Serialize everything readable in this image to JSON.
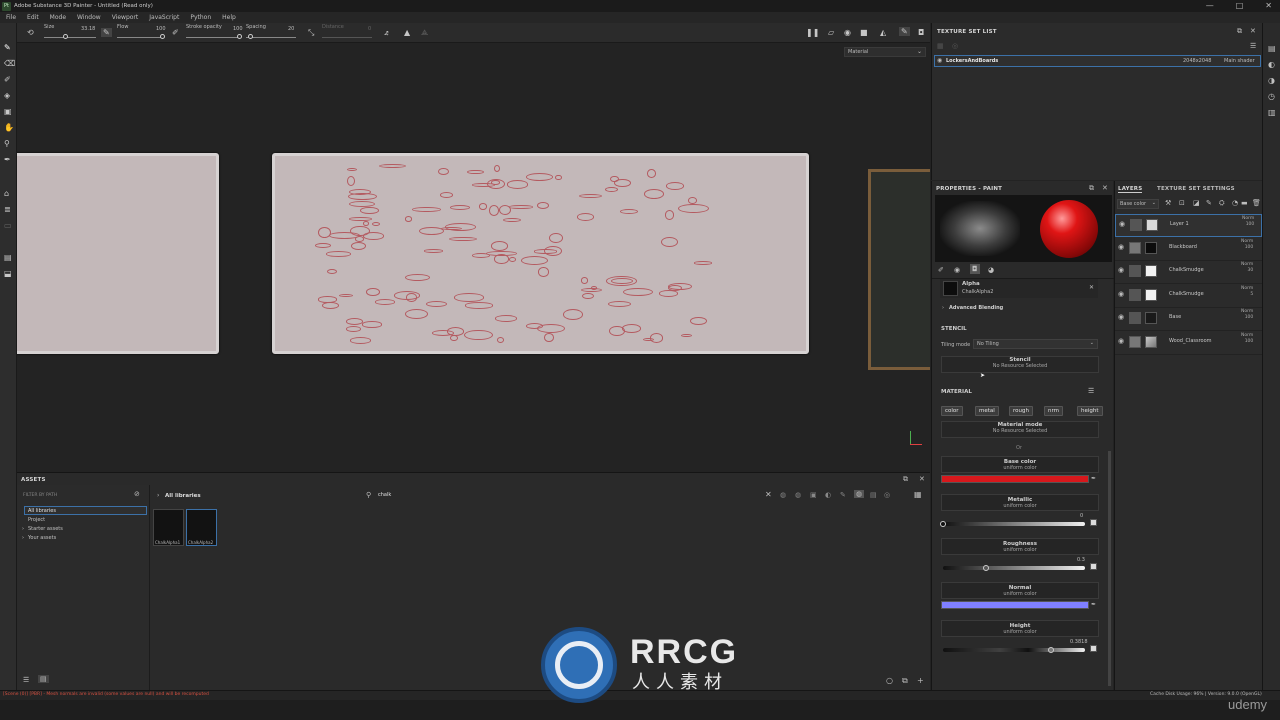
{
  "app": {
    "title": "Adobe Substance 3D Painter - Untitled (Read only)",
    "logo_text": "Pt",
    "window_controls": [
      "—",
      "□",
      "✕"
    ]
  },
  "menu": [
    "File",
    "Edit",
    "Mode",
    "Window",
    "Viewport",
    "JavaScript",
    "Python",
    "Help"
  ],
  "toolbar": {
    "size_label": "Size",
    "size_value": "33.18",
    "size_level": 0.43,
    "flow_label": "Flow",
    "flow_value": "100",
    "flow_level": 1.0,
    "stroke_opacity_label": "Stroke opacity",
    "stroke_opacity_value": "100",
    "stroke_opacity_level": 1.0,
    "spacing_label": "Spacing",
    "spacing_value": "20",
    "spacing_level": 0.1,
    "distance_label": "Distance",
    "distance_value": "0",
    "viewport_dropdown": "Material"
  },
  "texture_set_list": {
    "header": "TEXTURE SET LIST",
    "row": {
      "name": "LockersAndBoards",
      "resolution": "2048x2048",
      "shader": "Main shader"
    }
  },
  "properties": {
    "header": "PROPERTIES - PAINT",
    "alpha": {
      "title": "Alpha",
      "value": "ChalkAlpha2"
    },
    "advanced_blending": "Advanced Blending",
    "stencil_section": "STENCIL",
    "tiling_mode_label": "Tiling mode",
    "tiling_mode_value": "No Tiling",
    "stencil_title": "Stencil",
    "stencil_value": "No Resource Selected",
    "material_section": "MATERIAL",
    "channels": [
      "color",
      "metal",
      "rough",
      "nrm",
      "height"
    ],
    "material_mode_title": "Material mode",
    "material_mode_value": "No Resource Selected",
    "or_label": "Or",
    "base_color": {
      "title": "Base color",
      "sub": "uniform color",
      "color": "#d7181c"
    },
    "metallic": {
      "title": "Metallic",
      "sub": "uniform color",
      "value": "0",
      "level": 0
    },
    "roughness": {
      "title": "Roughness",
      "sub": "uniform color",
      "value": "0.3",
      "level": 0.3
    },
    "normal": {
      "title": "Normal",
      "sub": "uniform color",
      "color": "#8080ff"
    },
    "height": {
      "title": "Height",
      "sub": "uniform color",
      "value": "0.3818",
      "level": 0.76
    }
  },
  "layers_panel": {
    "tab_layers": "LAYERS",
    "tab_tss": "TEXTURE SET SETTINGS",
    "channel_dropdown": "Base color",
    "rows": [
      {
        "name": "Layer 1",
        "mode": "Norm",
        "opacity": "100",
        "selected": true
      },
      {
        "name": "Blackboard",
        "mode": "Norm",
        "opacity": "100",
        "selected": false
      },
      {
        "name": "ChalkSmudge",
        "mode": "Norm",
        "opacity": "30",
        "selected": false
      },
      {
        "name": "ChalkSmudge",
        "mode": "Norm",
        "opacity": "5",
        "selected": false
      },
      {
        "name": "Base",
        "mode": "Norm",
        "opacity": "100",
        "selected": false
      },
      {
        "name": "Wood_Classroom",
        "mode": "Norm",
        "opacity": "100",
        "selected": false
      }
    ]
  },
  "assets": {
    "header": "ASSETS",
    "filter_label": "FILTER BY PATH",
    "tree": [
      "All libraries",
      "Project",
      "Starter assets",
      "Your assets"
    ],
    "breadcrumb": "All libraries",
    "search_value": "chalk",
    "items": [
      "ChalkAlpha1",
      "ChalkAlpha2"
    ]
  },
  "status": {
    "left": "[Scene (0)] [PBR] - Mesh normals are invalid (some values are null) and will be recomputed",
    "right": "Cache Disk Usage:  96% | Version: 9.0.0 (OpenGL)"
  },
  "watermark": {
    "logo": "RRCG",
    "sub": "人人素材",
    "brand": "udemy"
  }
}
